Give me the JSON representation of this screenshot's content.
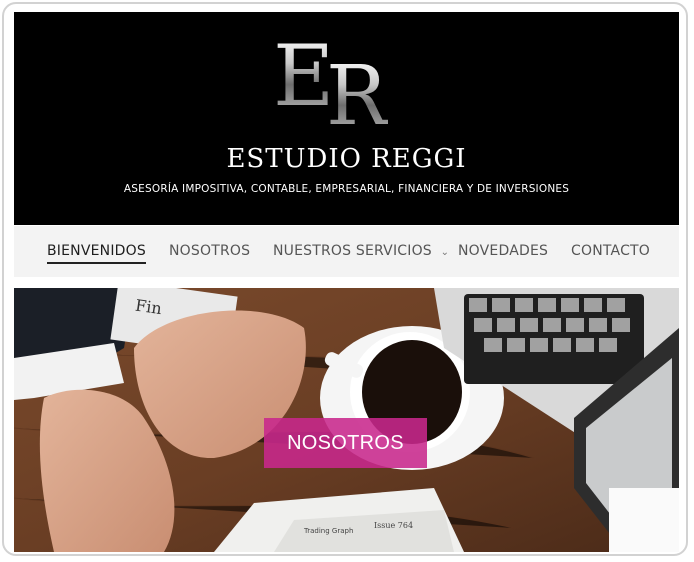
{
  "header": {
    "logo_letters": {
      "e": "E",
      "r": "R"
    },
    "site_title": "ESTUDIO REGGI",
    "tagline": "ASESORÍA IMPOSITIVA, CONTABLE, EMPRESARIAL, FINANCIERA Y DE INVERSIONES"
  },
  "nav": {
    "items": [
      {
        "label": "BIENVENIDOS",
        "active": true
      },
      {
        "label": "NOSOTROS"
      },
      {
        "label": "NUESTROS SERVICIOS",
        "has_dropdown": true
      },
      {
        "label": "NOVEDADES"
      },
      {
        "label": "CONTACTO"
      }
    ],
    "dropdown_icon": "chevron-down-icon"
  },
  "hero": {
    "image_desc": "office desk photo with laptop, coffee cup and papers",
    "cta_label": "NOSOTROS",
    "cta_color": "#c8288c",
    "paper_texts": {
      "fin": "Fin",
      "trading_graph": "Trading Graph",
      "issue": "Issue 764"
    }
  },
  "colors": {
    "header_bg": "#000000",
    "nav_bg": "#f3f3f3",
    "nav_text": "#555555",
    "nav_active": "#1e1e1e"
  }
}
